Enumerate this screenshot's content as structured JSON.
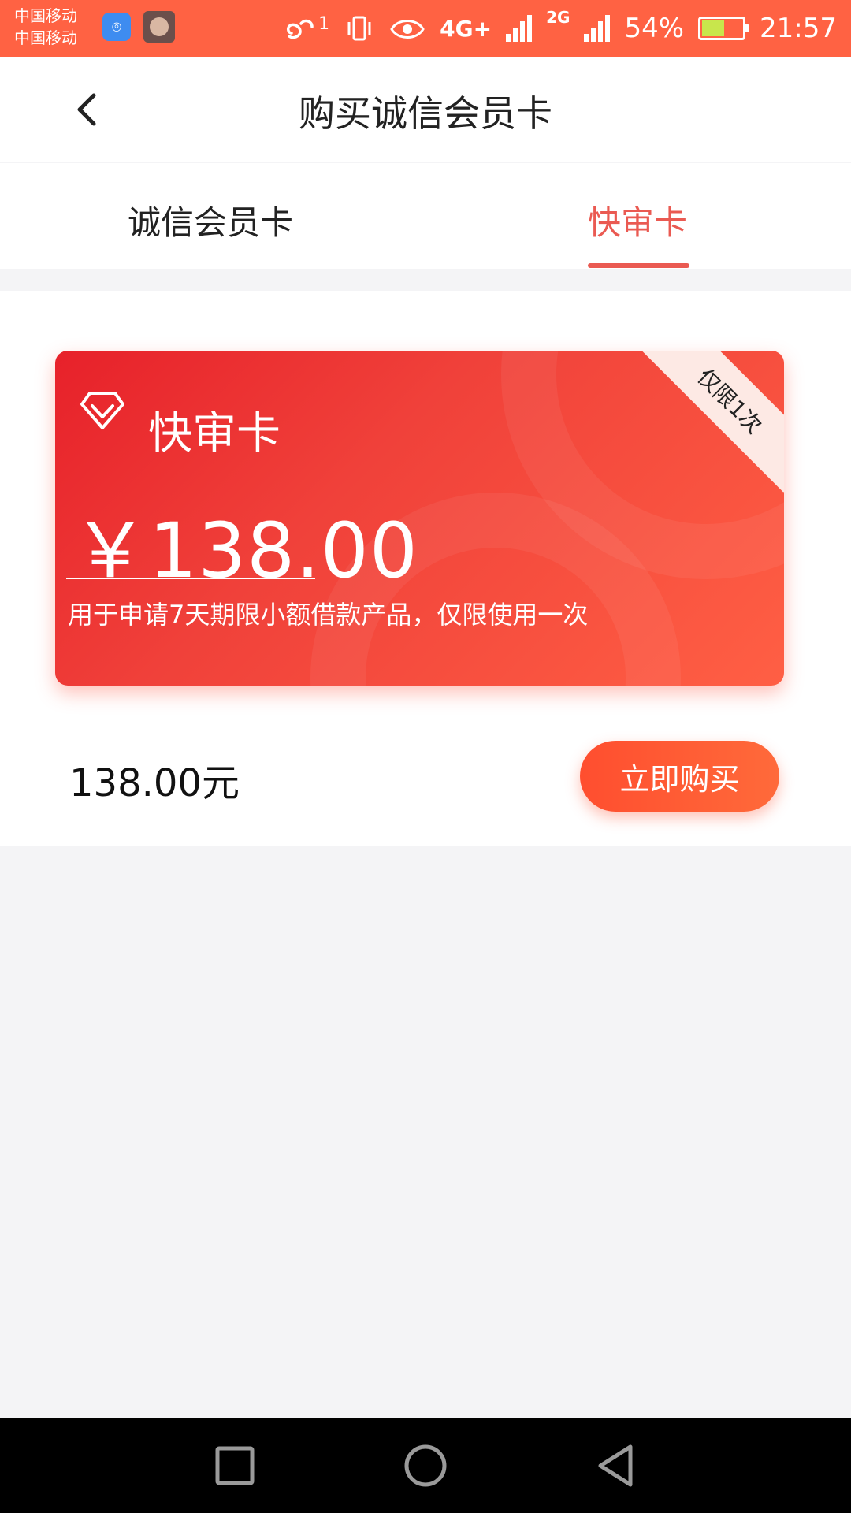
{
  "status_bar": {
    "carrier_1": "中国移动",
    "carrier_2": "中国移动",
    "sim_indicator": "1",
    "network_4g": "4G+",
    "network_2g": "2G",
    "battery": "54%",
    "time": "21:57"
  },
  "header": {
    "title": "购买诚信会员卡"
  },
  "tabs": [
    {
      "label": "诚信会员卡"
    },
    {
      "label": "快审卡"
    }
  ],
  "card": {
    "title": "快审卡",
    "price": "￥138.00",
    "ribbon": "仅限1次",
    "description": "用于申请7天期限小额借款产品，仅限使用一次"
  },
  "purchase": {
    "total": "138.00元",
    "buy_label": "立即购买"
  },
  "colors": {
    "status_bar": "#ff6243",
    "accent": "#ea5a52",
    "card_gradient_start": "#e7212a",
    "card_gradient_end": "#ff5f44"
  }
}
